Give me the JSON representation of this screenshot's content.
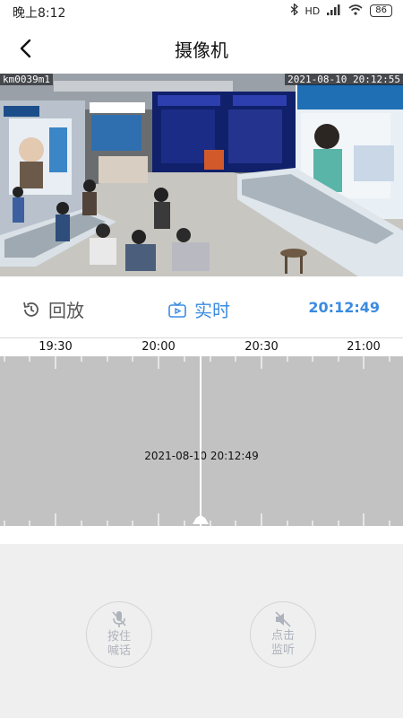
{
  "status_bar": {
    "time": "晚上8:12",
    "network": "HD",
    "battery": "86"
  },
  "nav": {
    "title": "摄像机"
  },
  "video": {
    "camera_label": "km0039m1",
    "osd_datetime": "2021-08-10 20:12:55"
  },
  "controls": {
    "playback_label": "回放",
    "live_label": "实时",
    "current_time": "20:12:49"
  },
  "timeline": {
    "labels": [
      "19:30",
      "20:00",
      "20:30",
      "21:00"
    ],
    "current_datetime": "2021-08-10 20:12:49"
  },
  "actions": {
    "talk_line1": "按住",
    "talk_line2": "喊话",
    "listen_line1": "点击",
    "listen_line2": "监听"
  },
  "colors": {
    "accent": "#3b8be0",
    "track": "#c2c2c2",
    "muted": "#aeb3bb"
  }
}
